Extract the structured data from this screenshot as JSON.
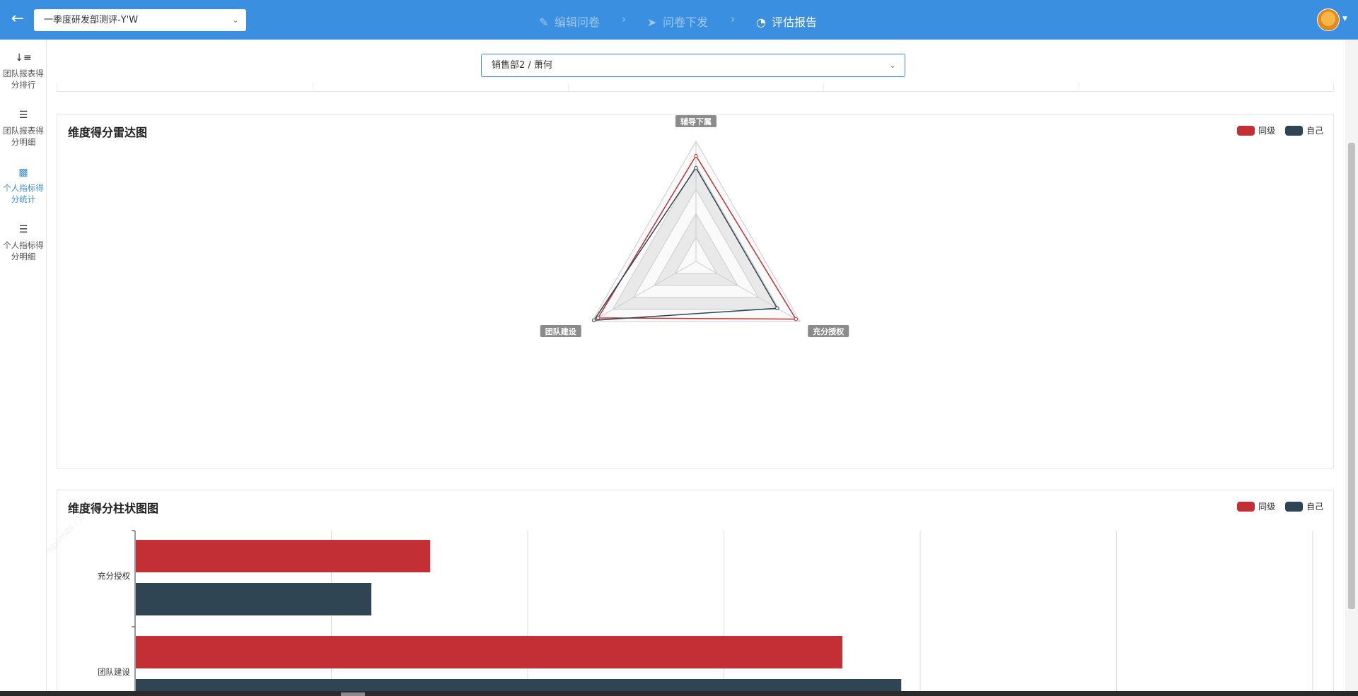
{
  "header": {
    "survey_select_value": "一季度研发部测评-Y'W",
    "steps": [
      {
        "label": "编辑问卷",
        "icon": "pencil-icon"
      },
      {
        "label": "问卷下发",
        "icon": "paper-plane-icon"
      },
      {
        "label": "评估报告",
        "icon": "pie-chart-icon"
      }
    ],
    "active_step": 2
  },
  "sidenav": {
    "items": [
      {
        "label": "团队报表得分排行",
        "icon": "sort-desc-icon"
      },
      {
        "label": "团队报表得分明细",
        "icon": "list-icon"
      },
      {
        "label": "个人指标得分统计",
        "icon": "bar-chart-icon"
      },
      {
        "label": "个人指标得分明细",
        "icon": "list-icon"
      }
    ],
    "active_index": 2
  },
  "main": {
    "person_select_value": "销售部2 / 萧何",
    "watermark_text": "yingxin686 / 万门"
  },
  "colors": {
    "primary": "#3b8fe0",
    "peer": "#c23035",
    "self": "#2f4554"
  },
  "chart_data": [
    {
      "type": "radar",
      "title": "维度得分雷达图",
      "legend": [
        "同级",
        "自己"
      ],
      "legend_position": "top-right",
      "indicators": [
        "辅导下属",
        "充分授权",
        "团队建设"
      ],
      "series": [
        {
          "name": "同级",
          "values": [
            4.4,
            4.8,
            4.7
          ]
        },
        {
          "name": "自己",
          "values": [
            3.9,
            3.9,
            4.9
          ]
        }
      ],
      "max": 5,
      "split_number": 5
    },
    {
      "type": "bar",
      "orientation": "horizontal",
      "title": "维度得分柱状图图",
      "legend": [
        "同级",
        "自己"
      ],
      "legend_position": "top-right",
      "categories": [
        "充分授权",
        "团队建设"
      ],
      "series": [
        {
          "name": "同级",
          "values": [
            1.5,
            3.6
          ]
        },
        {
          "name": "自己",
          "values": [
            1.2,
            3.9
          ]
        }
      ],
      "xlim": [
        0,
        6
      ],
      "grid": true
    }
  ]
}
